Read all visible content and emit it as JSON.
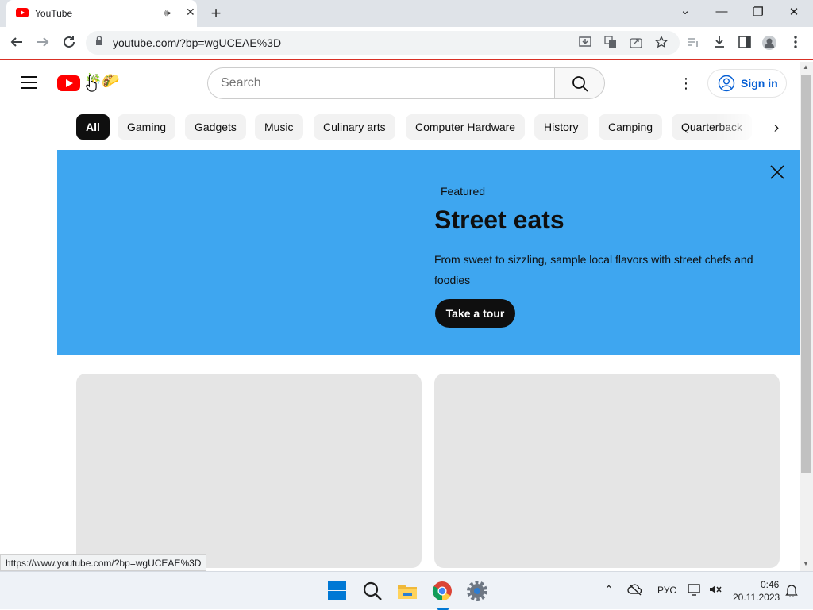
{
  "browser": {
    "tab_title": "YouTube",
    "audio_icon": "🕪",
    "close_glyph": "✕",
    "new_tab_glyph": "+",
    "address_url": "youtube.com/?bp=wgUCEAE%3D",
    "status_url": "https://www.youtube.com/?bp=wgUCEAE%3D",
    "window_controls": {
      "minimize": "—",
      "restore": "❐",
      "close": "✕",
      "dropdown": "⌄"
    }
  },
  "youtube": {
    "search_placeholder": "Search",
    "sign_in_label": "Sign in",
    "more_glyph": "⋮",
    "doodle_glyphs": "🎋🌮",
    "chips": [
      "All",
      "Gaming",
      "Gadgets",
      "Music",
      "Culinary arts",
      "Computer Hardware",
      "History",
      "Camping",
      "Quarterback"
    ],
    "chip_next_glyph": "›",
    "banner": {
      "kicker": "Featured",
      "headline": "Street eats",
      "description": "From sweet to sizzling, sample local flavors with street chefs and foodies",
      "cta": "Take a tour"
    },
    "accent_color": "#ff0000",
    "banner_color": "#3ea6f0",
    "link_color": "#065fd4"
  },
  "taskbar": {
    "language": "РУС",
    "time": "0:46",
    "date": "20.11.2023",
    "tray_up_glyph": "⌃"
  }
}
